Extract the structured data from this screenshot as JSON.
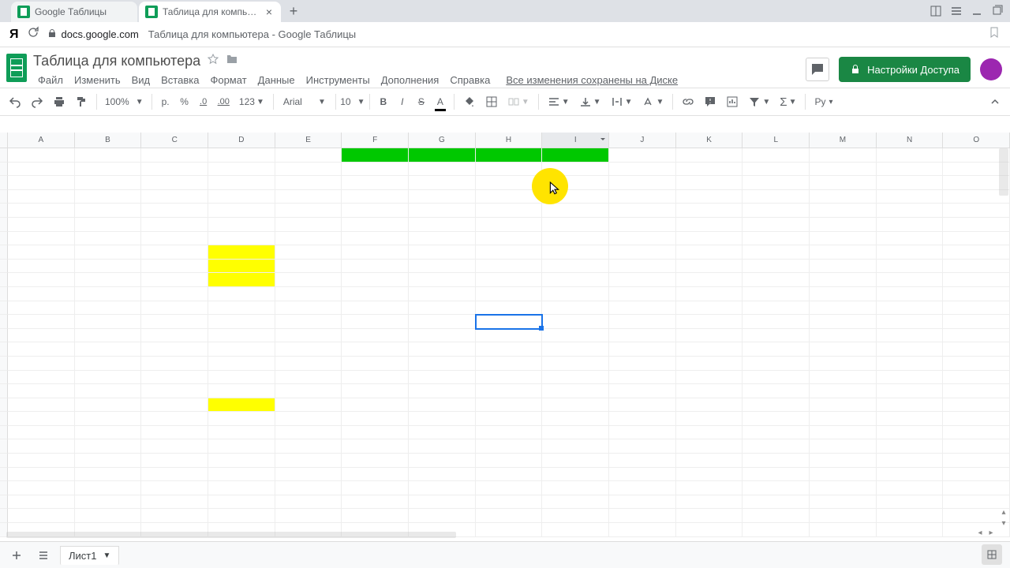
{
  "browser": {
    "tabs": [
      {
        "label": "Google Таблицы",
        "active": false
      },
      {
        "label": "Таблица для компьюте...",
        "active": true
      }
    ],
    "url_domain": "docs.google.com",
    "url_title": "Таблица для компьютера - Google Таблицы"
  },
  "doc": {
    "title": "Таблица для компьютера",
    "menus": [
      "Файл",
      "Изменить",
      "Вид",
      "Вставка",
      "Формат",
      "Данные",
      "Инструменты",
      "Дополнения",
      "Справка"
    ],
    "saved_text": "Все изменения сохранены на Диске",
    "share_label": "Настройки Доступа"
  },
  "toolbar": {
    "zoom": "100%",
    "currency": "р.",
    "percent": "%",
    "dec_less": ".0",
    "dec_more": ".00",
    "format123": "123",
    "font": "Arial",
    "font_size": "10",
    "lang": "Ру"
  },
  "grid": {
    "columns": [
      "A",
      "B",
      "C",
      "D",
      "E",
      "F",
      "G",
      "H",
      "I",
      "J",
      "K",
      "L",
      "M",
      "N",
      "O"
    ],
    "selected_column": "I",
    "selected_cell": {
      "row": 12,
      "col": 7
    },
    "fills": [
      {
        "row": 0,
        "colStart": 5,
        "colEnd": 8,
        "color": "green"
      },
      {
        "row": 7,
        "colStart": 3,
        "colEnd": 3,
        "color": "yellow"
      },
      {
        "row": 8,
        "colStart": 3,
        "colEnd": 3,
        "color": "yellow"
      },
      {
        "row": 9,
        "colStart": 3,
        "colEnd": 3,
        "color": "yellow"
      },
      {
        "row": 18,
        "colStart": 3,
        "colEnd": 3,
        "color": "yellow"
      }
    ],
    "visible_rows": 28
  },
  "sheets": {
    "active": "Лист1"
  }
}
